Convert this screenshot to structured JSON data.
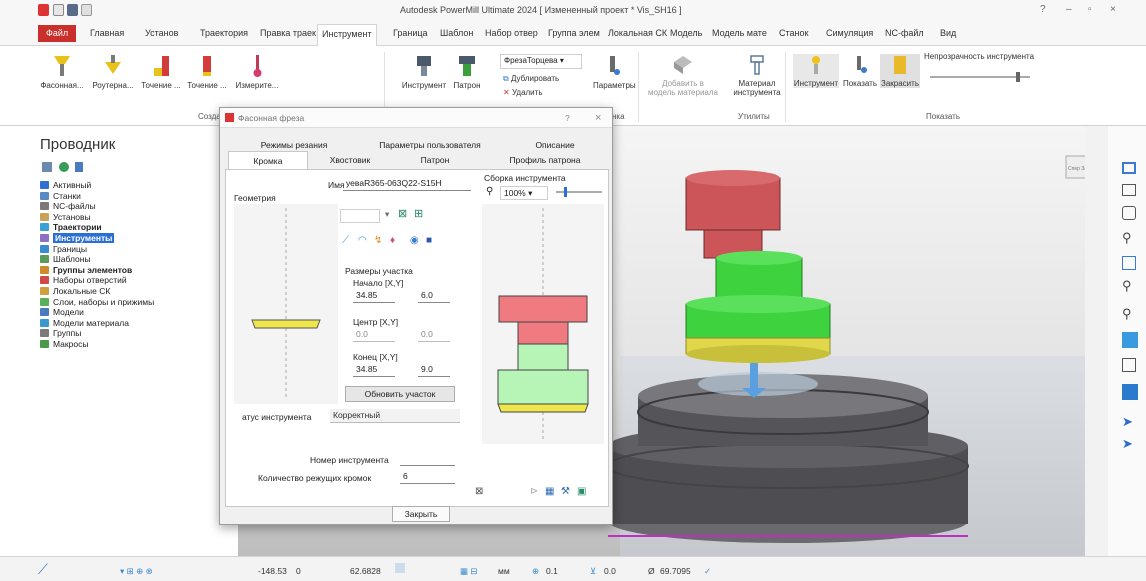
{
  "app": {
    "title": "Autodesk PowerMill Ultimate 2024   [ Измененный проект * Vis_SH16 ]",
    "help": "?",
    "minimize": "–",
    "close": "×"
  },
  "tabs": {
    "file": "Файл",
    "items": [
      "Главная",
      "Установ",
      "Траектория",
      "Правка траек",
      "Инструмент",
      "Граница",
      "Шаблон",
      "Набор отвер",
      "Группа элем",
      "Локальная СК",
      "Модель",
      "Модель мате",
      "Станок",
      "Симуляция",
      "NC-файл",
      "Вид"
    ]
  },
  "ribbon": {
    "create_tools": [
      "Фасонная...",
      "Роутерна...",
      "Точение ...",
      "Точение ...",
      "Измерите..."
    ],
    "tool_btn": "Инструмент",
    "holder_btn": "Патрон",
    "tool_dropdown": "ФрезаТорцева",
    "duplicate": "Дублировать",
    "delete": "Удалить",
    "params": "Параметры",
    "add_model": "Добавить в",
    "add_model2": "модель материала",
    "tool_material": "Материал",
    "tool_material2": "инструмента",
    "show_tool": "Инструмент",
    "show_btn": "Показать",
    "shade_btn": "Закрасить",
    "transparency": "Непрозрачность инструмента",
    "group_create": "Создать",
    "group_misc": "нка",
    "group_utils": "Утилиты",
    "group_show": "Показать"
  },
  "explorer": {
    "title": "Проводник",
    "items": [
      {
        "label": "Активный",
        "bold": false,
        "color": "#2e6fd1"
      },
      {
        "label": "Станки",
        "bold": false,
        "color": "#5a8ac6"
      },
      {
        "label": "NC-файлы",
        "bold": false,
        "color": "#7a7a7a"
      },
      {
        "label": "Установы",
        "bold": false,
        "color": "#c8a25a"
      },
      {
        "label": "Траектории",
        "bold": true,
        "color": "#3aa0d8"
      },
      {
        "label": "Инструменты",
        "bold": true,
        "color": "#8a6fc2",
        "selected": true
      },
      {
        "label": "Границы",
        "bold": false,
        "color": "#3a8bd0"
      },
      {
        "label": "Шаблоны",
        "bold": false,
        "color": "#5a9a5a"
      },
      {
        "label": "Группы элементов",
        "bold": true,
        "color": "#d08a2a"
      },
      {
        "label": "Наборы отверстий",
        "bold": false,
        "color": "#d04a4a"
      },
      {
        "label": "Локальные СК",
        "bold": false,
        "color": "#d0a03a"
      },
      {
        "label": "Слои, наборы и прижимы",
        "bold": false,
        "color": "#5ab05a"
      },
      {
        "label": "Модели",
        "bold": false,
        "color": "#4a7ac0"
      },
      {
        "label": "Модели материала",
        "bold": false,
        "color": "#3a9ad0"
      },
      {
        "label": "Группы",
        "bold": false,
        "color": "#7a7a7a"
      },
      {
        "label": "Макросы",
        "bold": false,
        "color": "#4a9a4a"
      }
    ]
  },
  "dialog": {
    "title": "Фасонная фреза",
    "help": "?",
    "close": "×",
    "tabs_row1": [
      "Режимы резания",
      "Параметры пользователя",
      "Описание"
    ],
    "tabs_row2": [
      "Кромка",
      "Хвостовик",
      "Патрон",
      "Профиль патрона"
    ],
    "name_label": "Имя",
    "name_value": "уевaR365-063Q22-S15H",
    "geometry_label": "Геометрия",
    "section_label": "Размеры участка",
    "start_label": "Начало [X,Y]",
    "start_x": "34.85",
    "start_y": "6.0",
    "center_label": "Центр [X,Y]",
    "center_x": "0.0",
    "center_y": "0.0",
    "end_label": "Конец [X,Y]",
    "end_x": "34.85",
    "end_y": "9.0",
    "update_btn": "Обновить участок",
    "status_label": "атус инструмента",
    "status_value": "Корректный",
    "assembly_label": "Сборка инструмента",
    "zoom": "100%",
    "tool_number_label": "Номер инструмента",
    "tool_number_value": "",
    "flutes_label": "Количество режущих кромок",
    "flutes_value": "6",
    "close_btn": "Закрыть"
  },
  "viewcube": "Спер Зад",
  "status": {
    "coord1": "-148.53",
    "coord2": "0",
    "coord3": "62.6828",
    "unit": "мм",
    "tol": "0.1",
    "thick": "0.0",
    "diam": "69.7095"
  },
  "colors": {
    "accent": "#c9302c",
    "select": "#2a6fd6",
    "red": "#d6555a",
    "green": "#3fd23f",
    "yellow": "#e8e04a",
    "steel": "#5a5a5d"
  }
}
